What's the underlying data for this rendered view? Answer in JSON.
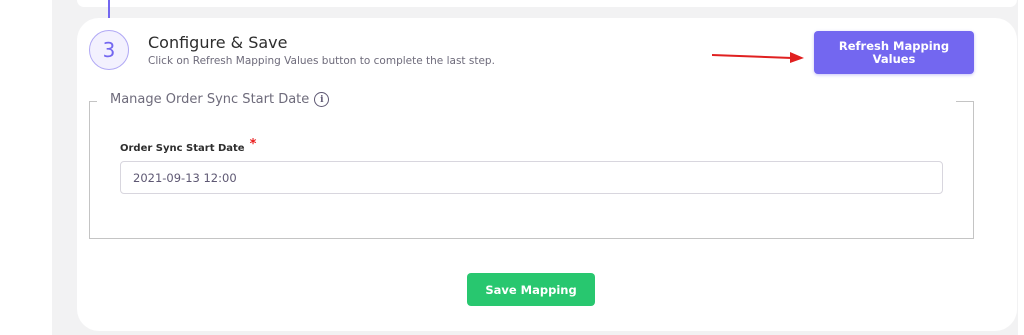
{
  "step": {
    "number": "3",
    "title": "Configure & Save",
    "description": "Click on Refresh Mapping Values button to complete the last step."
  },
  "actions": {
    "refresh_label": "Refresh Mapping Values",
    "save_label": "Save Mapping"
  },
  "section": {
    "legend": "Manage Order Sync Start Date",
    "info_icon_glyph": "i",
    "field_label": "Order Sync Start Date",
    "required_marker": "*",
    "field_value": "2021-09-13 12:00"
  },
  "colors": {
    "accent": "#7367f0",
    "success": "#28c76f",
    "required": "#ea1c1c",
    "annotation_arrow": "#e02020"
  },
  "icons": {
    "info": "info-circle-icon",
    "arrow": "arrow-right-icon"
  }
}
